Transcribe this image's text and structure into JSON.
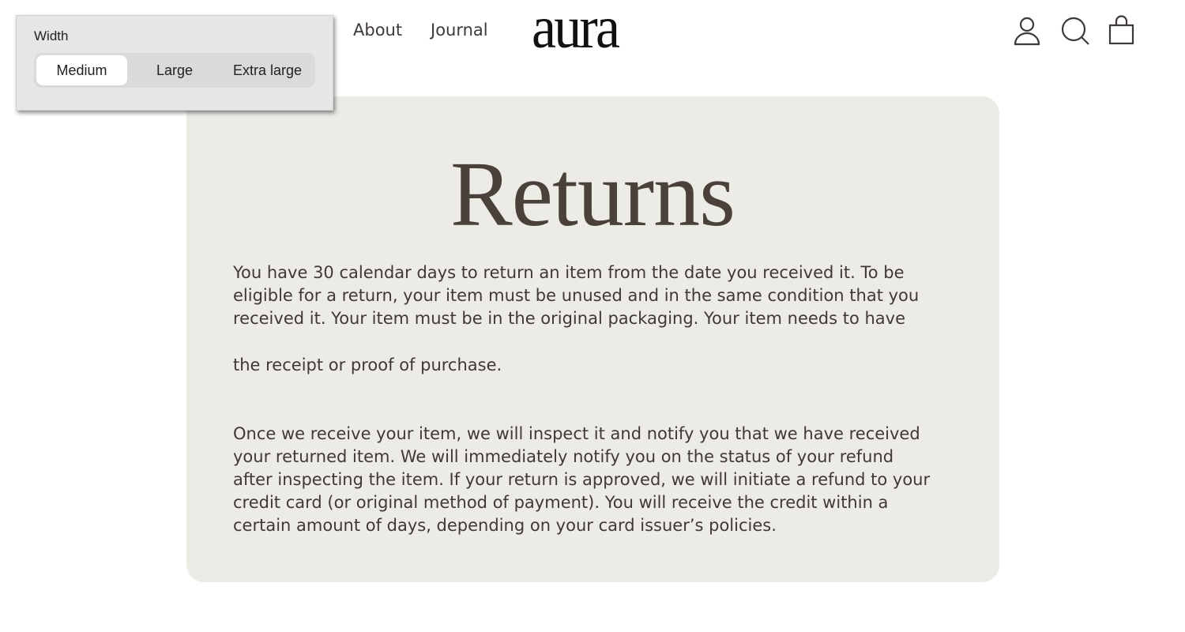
{
  "header": {
    "nav": [
      "About",
      "Journal"
    ],
    "logo": "aura",
    "icons": [
      "account-icon",
      "search-icon",
      "cart-icon"
    ]
  },
  "popup": {
    "label": "Width",
    "options": [
      "Medium",
      "Large",
      "Extra large"
    ],
    "selected": "Medium"
  },
  "page": {
    "title": "Returns",
    "paragraph1": [
      "You have 30 calendar days to return an item from the date you received it. To be",
      "eligible for a return, your item must be unused and in the same condition that you",
      "received it. Your item must be in the original packaging. Your item needs to have"
    ],
    "paragraph2": [
      "the receipt or proof of purchase."
    ],
    "paragraph3": [
      "Once we receive your item, we will inspect it and notify you that we have received",
      "your returned item. We will immediately notify you on the status of your refund",
      "after inspecting the item. If your return is approved, we will initiate a refund to your",
      "credit card (or original method of payment). You will receive the credit within a",
      "certain amount of days, depending on your card issuer’s policies."
    ]
  },
  "colors": {
    "card_bg": "#edebe6",
    "text": "#3f3935",
    "popup_bg": "#e6e6e6"
  }
}
